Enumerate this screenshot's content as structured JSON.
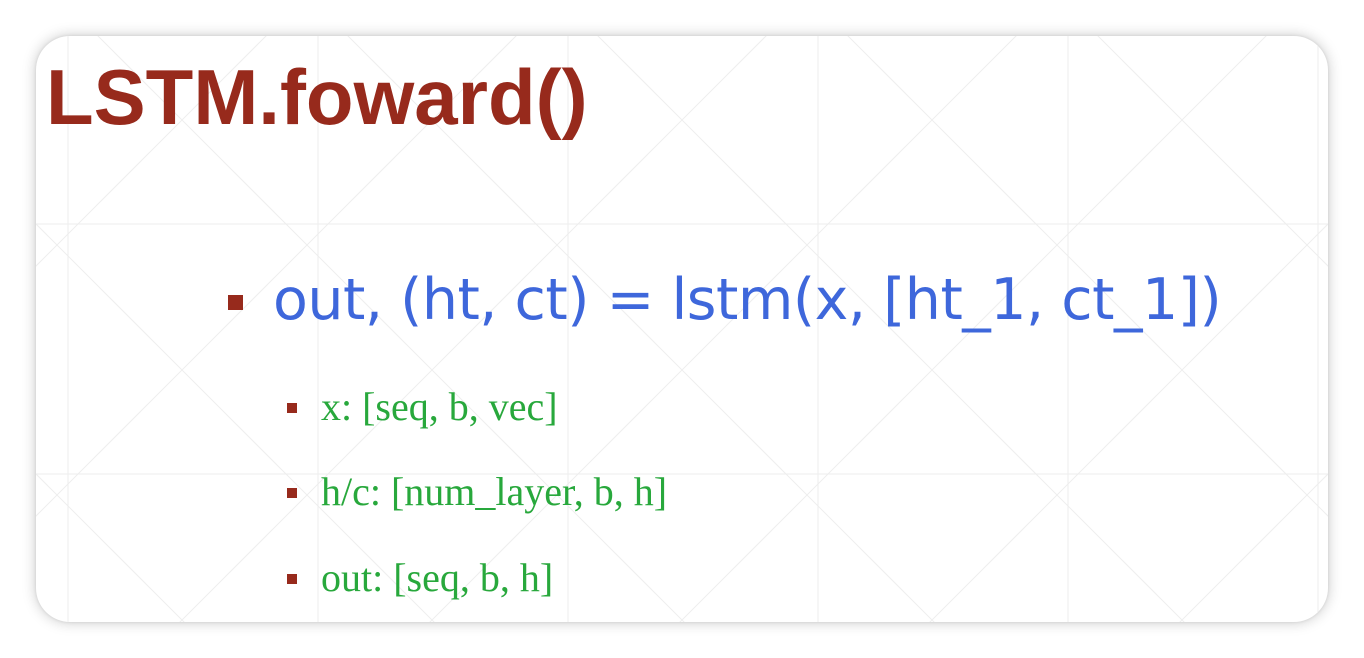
{
  "slide": {
    "title": "LSTM.foward()",
    "main_bullet": "out, (ht, ct) = lstm(x, [ht_1, ct_1])",
    "sub_bullets": [
      "x: [seq, b, vec]",
      "h/c: [num_layer, b, h]",
      "out: [seq, b, h]"
    ]
  },
  "colors": {
    "title": "#972a1c",
    "bullet_marker": "#972a1c",
    "main_text": "#3e67db",
    "sub_text": "#28a83c"
  }
}
